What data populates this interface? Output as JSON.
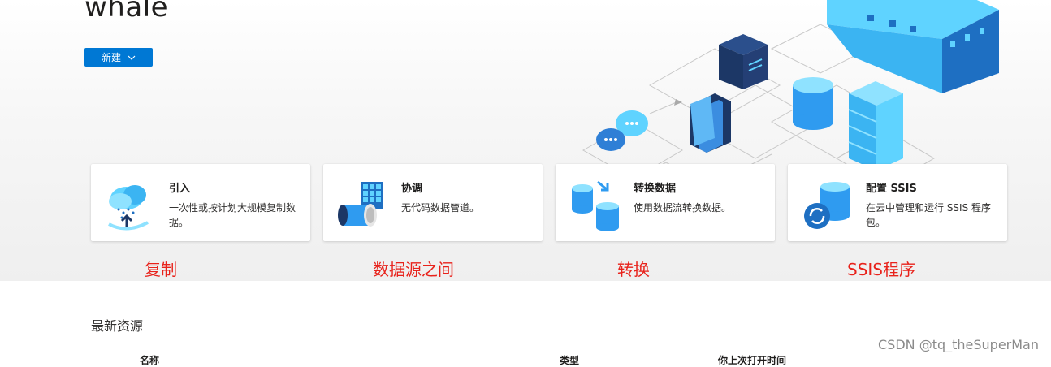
{
  "header": {
    "title": "whale",
    "new_button_label": "新建"
  },
  "cards": [
    {
      "title": "引入",
      "description": "一次性或按计划大规模复制数据。",
      "icon": "cloud-upload-icon"
    },
    {
      "title": "协调",
      "description": "无代码数据管道。",
      "icon": "pipeline-icon"
    },
    {
      "title": "转换数据",
      "description": "使用数据流转换数据。",
      "icon": "transform-data-icon"
    },
    {
      "title": "配置 SSIS",
      "description": "在云中管理和运行 SSIS 程序包。",
      "icon": "ssis-icon"
    }
  ],
  "annotations": [
    "复制",
    "数据源之间",
    "转换",
    "SSIS程序"
  ],
  "recent": {
    "title": "最新资源",
    "columns": [
      "名称",
      "类型",
      "你上次打开时间"
    ]
  },
  "watermark": "CSDN @tq_theSuperMan",
  "colors": {
    "accent": "#0078d4",
    "annotation": "#e8221b",
    "illustration_blue": "#2f9bf0",
    "illustration_cyan": "#5fd3ff"
  }
}
